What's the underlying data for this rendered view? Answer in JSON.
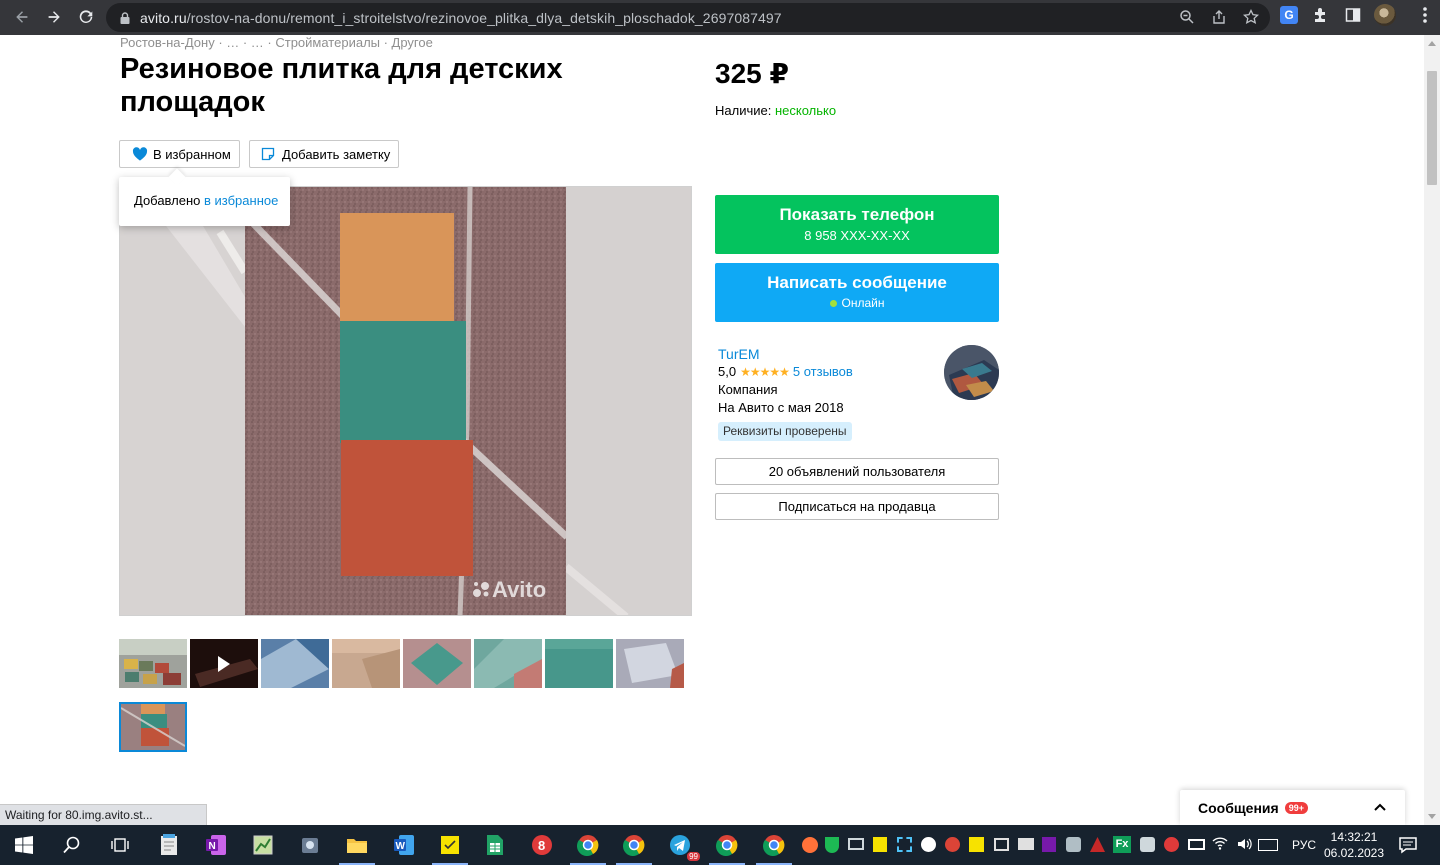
{
  "browser": {
    "url_host": "avito.ru",
    "url_path": "/rostov-na-donu/remont_i_stroitelstvo/rezinovoe_plitka_dlya_detskih_ploschadok_2697087497",
    "status_text": "Waiting for 80.img.avito.st..."
  },
  "listing": {
    "breadcrumb": "Ростов-на-Дону · … · … · Стройматериалы · Другое",
    "title": "Резиновое плитка для детских площадок",
    "favorite_label": "В избранном",
    "note_label": "Добавить заметку",
    "tooltip_text": "Добавлено ",
    "tooltip_link": "в избранное",
    "watermark": "Avito",
    "price": "325 ₽",
    "availability_label": "Наличие: ",
    "availability_value": "несколько",
    "thumbnails_count": 9
  },
  "contact": {
    "phone_button_label": "Показать телефон",
    "phone_masked": "8 958 XXX-XX-XX",
    "message_button_label": "Написать сообщение",
    "online_status": "Онлайн"
  },
  "seller": {
    "name": "TurEM",
    "rating": "5,0",
    "reviews": "5 отзывов",
    "type": "Компания",
    "since": "На Авито с мая 2018",
    "verified": "Реквизиты проверены",
    "listings_button": "20 объявлений пользователя",
    "subscribe_button": "Подписаться на продавца"
  },
  "messages_widget": {
    "label": "Сообщения",
    "badge": "99+"
  },
  "taskbar": {
    "language": "РУС",
    "time": "14:32:21",
    "date": "06.02.2023",
    "telegram_badge": "99"
  },
  "colors": {
    "green_button": "#04c35e",
    "blue_button": "#0fa9f5",
    "link": "#0a89d8",
    "available_green": "#04b400"
  }
}
